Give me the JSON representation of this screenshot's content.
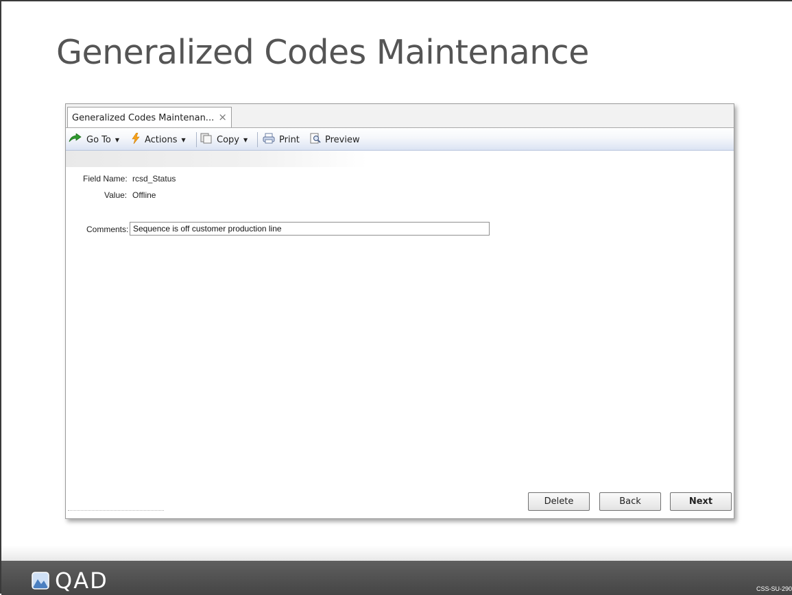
{
  "slide": {
    "title": "Generalized Codes Maintenance",
    "footer_logo": "QAD",
    "slide_code": "CSS-SU-290"
  },
  "window": {
    "tab": {
      "label": "Generalized Codes Maintenan...",
      "close_glyph": "×"
    },
    "toolbar": {
      "goto_label": "Go To",
      "actions_label": "Actions",
      "copy_label": "Copy",
      "print_label": "Print",
      "preview_label": "Preview",
      "dropdown_glyph": "▼",
      "icons": {
        "goto": "goto-arrow-icon",
        "actions": "actions-lightning-icon",
        "copy": "copy-icon",
        "print": "printer-icon",
        "preview": "preview-icon"
      }
    },
    "form": {
      "field_name_label": "Field Name:",
      "field_name_value": "rcsd_Status",
      "value_label": "Value:",
      "value_value": "Offline",
      "comments_label": "Comments:",
      "comments_value": "Sequence is off customer production line"
    },
    "buttons": {
      "delete_label": "Delete",
      "back_label": "Back",
      "next_label": "Next"
    }
  },
  "colors": {
    "title_text": "#555555",
    "toolbar_gradient_end": "#dbe3f3",
    "footer_bg": "#4f4f4f"
  }
}
